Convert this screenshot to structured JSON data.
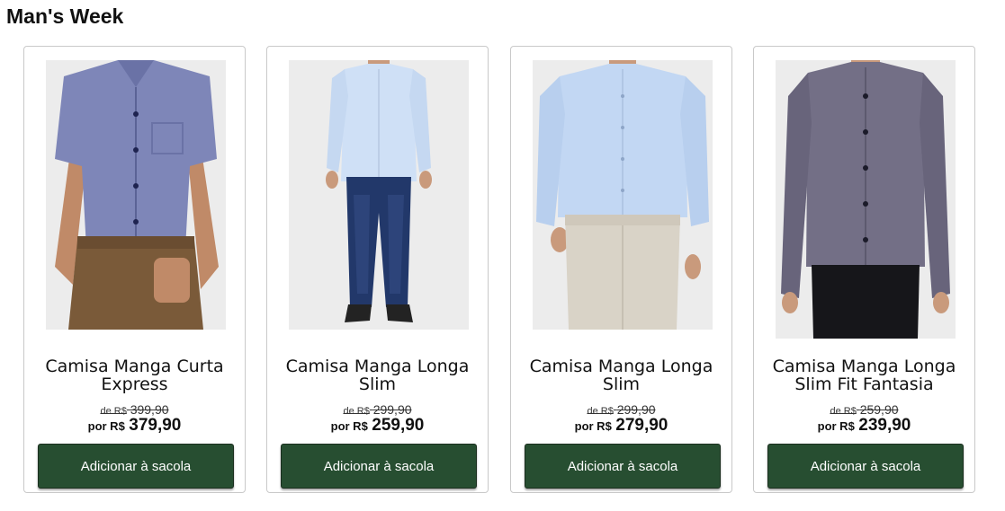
{
  "section": {
    "title": "Man's Week"
  },
  "products": [
    {
      "name": "Camisa Manga Curta Express",
      "old_prefix": "de R$",
      "old_price": "399,90",
      "new_prefix": "por R$",
      "new_price": "379,90",
      "button_label": "Adicionar à sacola",
      "shirt_color": "#7e86b8",
      "pants_color": "#7a5a39"
    },
    {
      "name": "Camisa Manga Longa Slim",
      "old_prefix": "de R$",
      "old_price": "299,90",
      "new_prefix": "por R$",
      "new_price": "259,90",
      "button_label": "Adicionar à sacola",
      "shirt_color": "#cfe0f6",
      "pants_color": "#22386a"
    },
    {
      "name": "Camisa Manga Longa Slim",
      "old_prefix": "de R$",
      "old_price": "299,90",
      "new_prefix": "por R$",
      "new_price": "279,90",
      "button_label": "Adicionar à sacola",
      "shirt_color": "#c2d7f3",
      "pants_color": "#d9d3c7"
    },
    {
      "name": "Camisa Manga Longa Slim Fit Fantasia",
      "old_prefix": "de R$",
      "old_price": "259,90",
      "new_prefix": "por R$",
      "new_price": "239,90",
      "button_label": "Adicionar à sacola",
      "shirt_color": "#736f86",
      "pants_color": "#16161a"
    }
  ],
  "colors": {
    "button_bg": "#274e31",
    "border": "#c9c9c9"
  }
}
